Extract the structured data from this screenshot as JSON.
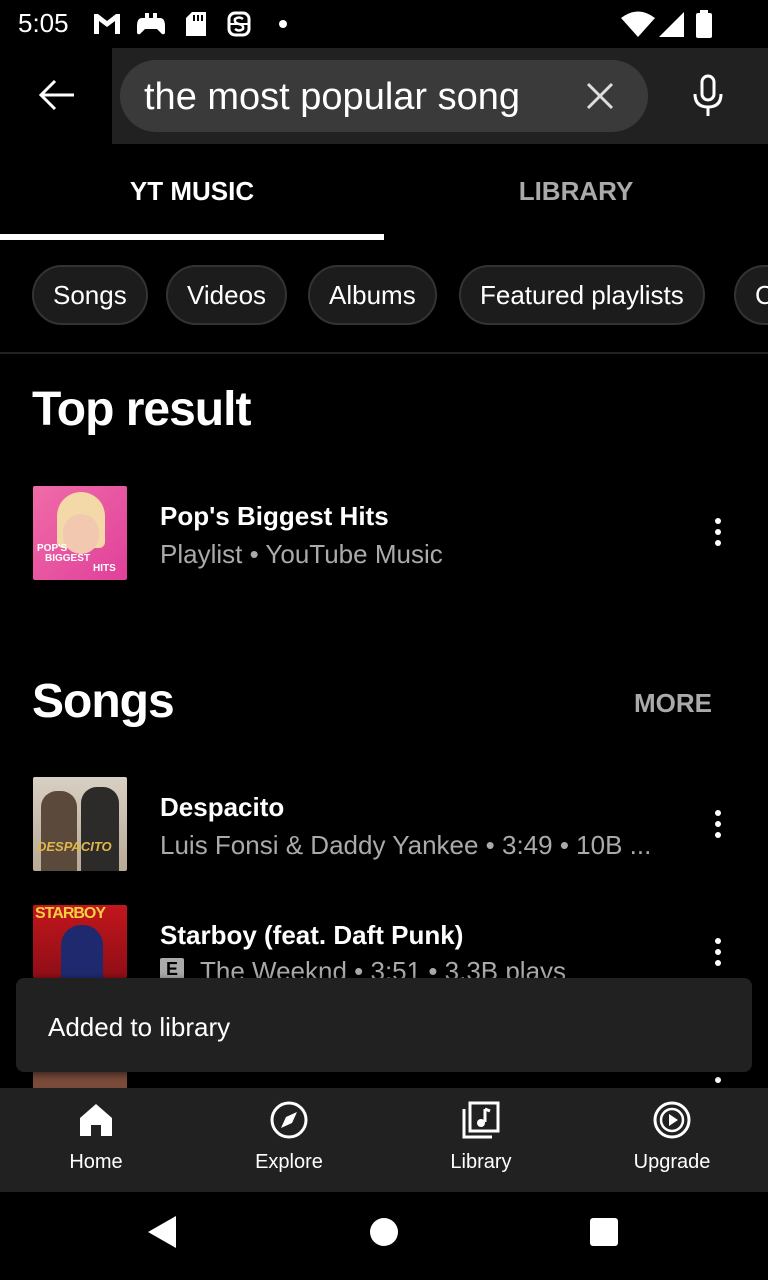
{
  "status_bar": {
    "time": "5:05"
  },
  "search": {
    "query": "the most popular song"
  },
  "tabs": [
    {
      "label": "YT MUSIC"
    },
    {
      "label": "LIBRARY"
    }
  ],
  "chips": [
    "Songs",
    "Videos",
    "Albums",
    "Featured playlists",
    "C"
  ],
  "top_result": {
    "heading": "Top result",
    "item": {
      "title": "Pop's Biggest Hits",
      "subtitle": "Playlist • YouTube Music",
      "thumb_text": [
        "POP'S",
        "BIGGEST",
        "HITS"
      ]
    }
  },
  "songs": {
    "heading": "Songs",
    "more_label": "MORE",
    "items": [
      {
        "title": "Despacito",
        "subtitle": "Luis Fonsi & Daddy Yankee • 3:49 • 10B ...",
        "thumb_text": "DESPACITO"
      },
      {
        "title": "Starboy (feat. Daft Punk)",
        "subtitle": "The Weeknd • 3:51 • 3.3B plays",
        "explicit": "E",
        "thumb_text": "STARBOY"
      }
    ]
  },
  "snackbar": {
    "text": "Added to library"
  },
  "bottom_nav": [
    {
      "label": "Home",
      "icon": "home-icon"
    },
    {
      "label": "Explore",
      "icon": "compass-icon"
    },
    {
      "label": "Library",
      "icon": "library-icon"
    },
    {
      "label": "Upgrade",
      "icon": "upgrade-icon"
    }
  ],
  "colors": {
    "background": "#000000",
    "surface": "#212121",
    "secondary_text": "#aaaaaa"
  }
}
